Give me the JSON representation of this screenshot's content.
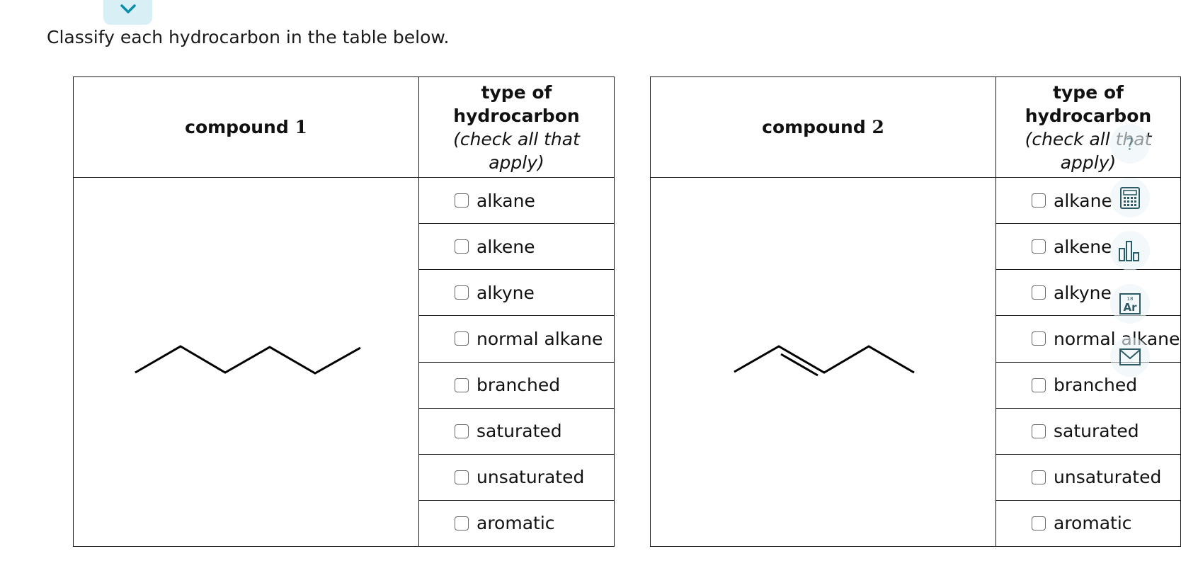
{
  "instructions": "Classify each hydrocarbon in the table below.",
  "compounds": [
    {
      "heading_prefix": "compound",
      "number": "1",
      "type_heading_line1": "type of",
      "type_heading_line2": "hydrocarbon",
      "type_heading_line3": "(check all that",
      "type_heading_line4": "apply)",
      "structure_name": "skeletal-structure-compound-1"
    },
    {
      "heading_prefix": "compound",
      "number": "2",
      "type_heading_line1": "type of",
      "type_heading_line2": "hydrocarbon",
      "type_heading_line3": "(check all that",
      "type_heading_line4": "apply)",
      "structure_name": "skeletal-structure-compound-2"
    }
  ],
  "options": [
    "alkane",
    "alkene",
    "alkyne",
    "normal alkane",
    "branched",
    "saturated",
    "unsaturated",
    "aromatic"
  ],
  "tools": {
    "help": "help-icon",
    "calculator": "calculator-icon",
    "data": "bar-chart-icon",
    "periodic_table": "periodic-table-icon",
    "periodic_number": "18",
    "periodic_symbol": "Ar",
    "message": "envelope-icon"
  },
  "colors": {
    "accent": "#0a8fa8",
    "collapse_bg": "#d7eff5",
    "tool_icon": "#2d5b66"
  }
}
